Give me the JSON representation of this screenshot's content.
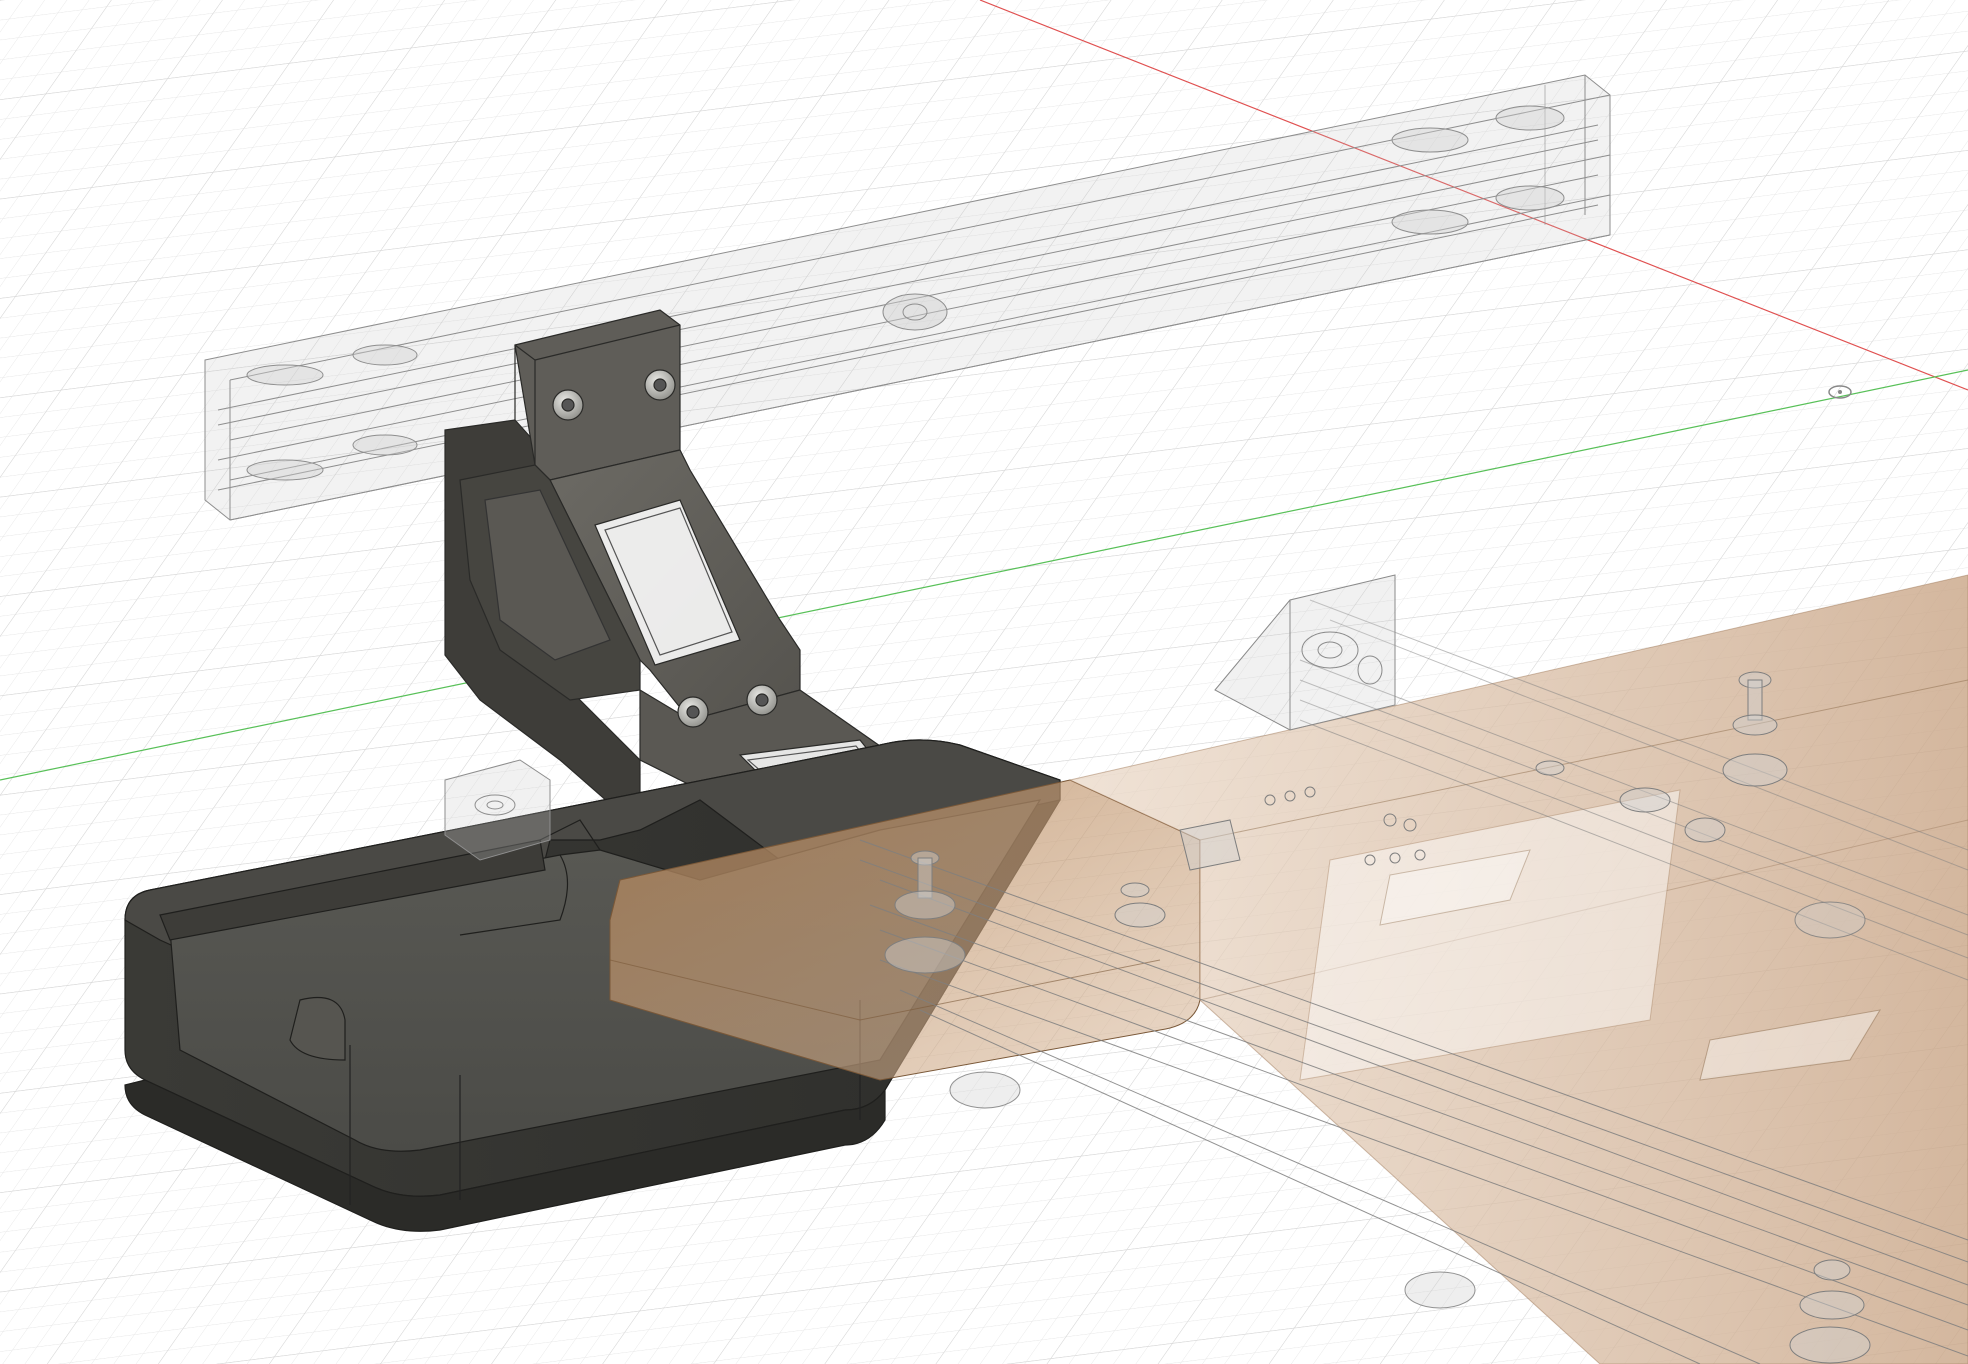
{
  "app": {
    "view_mode": "perspective",
    "visual_style": "shaded-with-visible-edges"
  },
  "scene": {
    "axes": {
      "x_color": "#e05050",
      "y_color": "#58c058"
    },
    "colors": {
      "background": "#ffffff",
      "grid_line": "#e4e4e4",
      "grid_major": "#d2d2d2",
      "solid_body": "#4a4a46",
      "solid_body_dark": "#363632",
      "solid_body_light": "#6a6a64",
      "ghost_edge": "#9a9a9a",
      "ghost_fill": "#bcbcbc",
      "wood_panel": "#a77a4f",
      "screw_metal": "#b8b8b4"
    },
    "components": [
      {
        "name": "aluminum-extrusion-upper",
        "state": "transparent"
      },
      {
        "name": "printed-bracket-arm",
        "state": "opaque"
      },
      {
        "name": "printed-tray",
        "state": "opaque"
      },
      {
        "name": "wood-panel",
        "state": "transparent"
      },
      {
        "name": "aluminum-extrusion-lower",
        "state": "transparent"
      },
      {
        "name": "corner-bracket",
        "state": "transparent"
      }
    ]
  }
}
